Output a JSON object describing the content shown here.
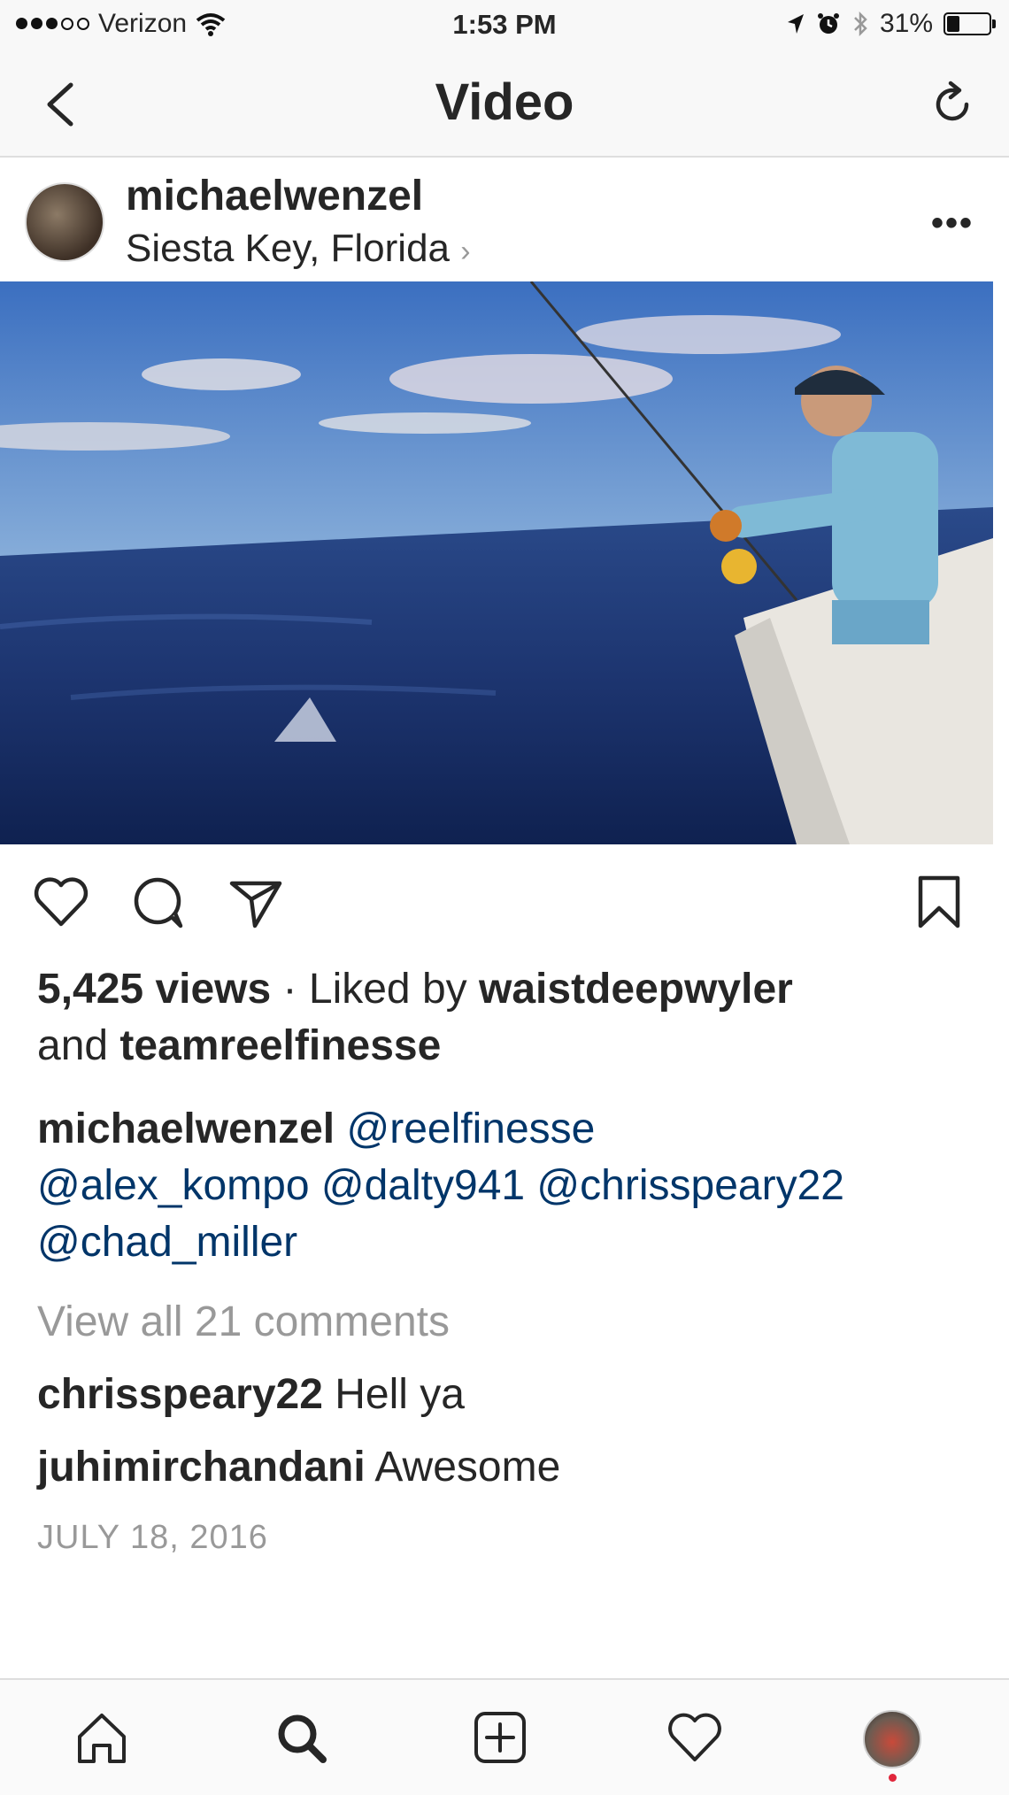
{
  "status_bar": {
    "carrier": "Verizon",
    "time": "1:53 PM",
    "battery": "31%",
    "battery_level": 0.31,
    "signal_bars_filled": 3,
    "signal_bars_total": 5
  },
  "nav": {
    "title": "Video",
    "back_icon": "chevron-left-icon",
    "refresh_icon": "refresh-icon"
  },
  "post": {
    "username": "michaelwenzel",
    "location": "Siesta Key, Florida",
    "location_chevron": "›",
    "more_label": "•••",
    "views": "5,425 views",
    "liked_sep": " · Liked by ",
    "liked_user": "waistdeepwyler",
    "liked_and": "and ",
    "liked_user2": "teamreelfinesse",
    "caption_user": "michaelwenzel",
    "mentions_line1": "@reelfinesse",
    "mentions_line2": "@alex_kompo @dalty941 @chrisspeary22",
    "mentions_line3": "@chad_miller",
    "view_all": "View all 21 comments",
    "comments": [
      {
        "user": "chrisspeary22",
        "text": "Hell ya"
      },
      {
        "user": "juhimirchandani",
        "text": "Awesome"
      }
    ],
    "date": "JULY 18, 2016"
  },
  "tabbar": {
    "items": [
      "home-icon",
      "search-icon",
      "new-post-icon",
      "activity-heart-icon",
      "profile-avatar"
    ]
  },
  "colors": {
    "link": "#003569",
    "muted": "#999999",
    "text": "#262626",
    "notification": "#e0263b"
  }
}
